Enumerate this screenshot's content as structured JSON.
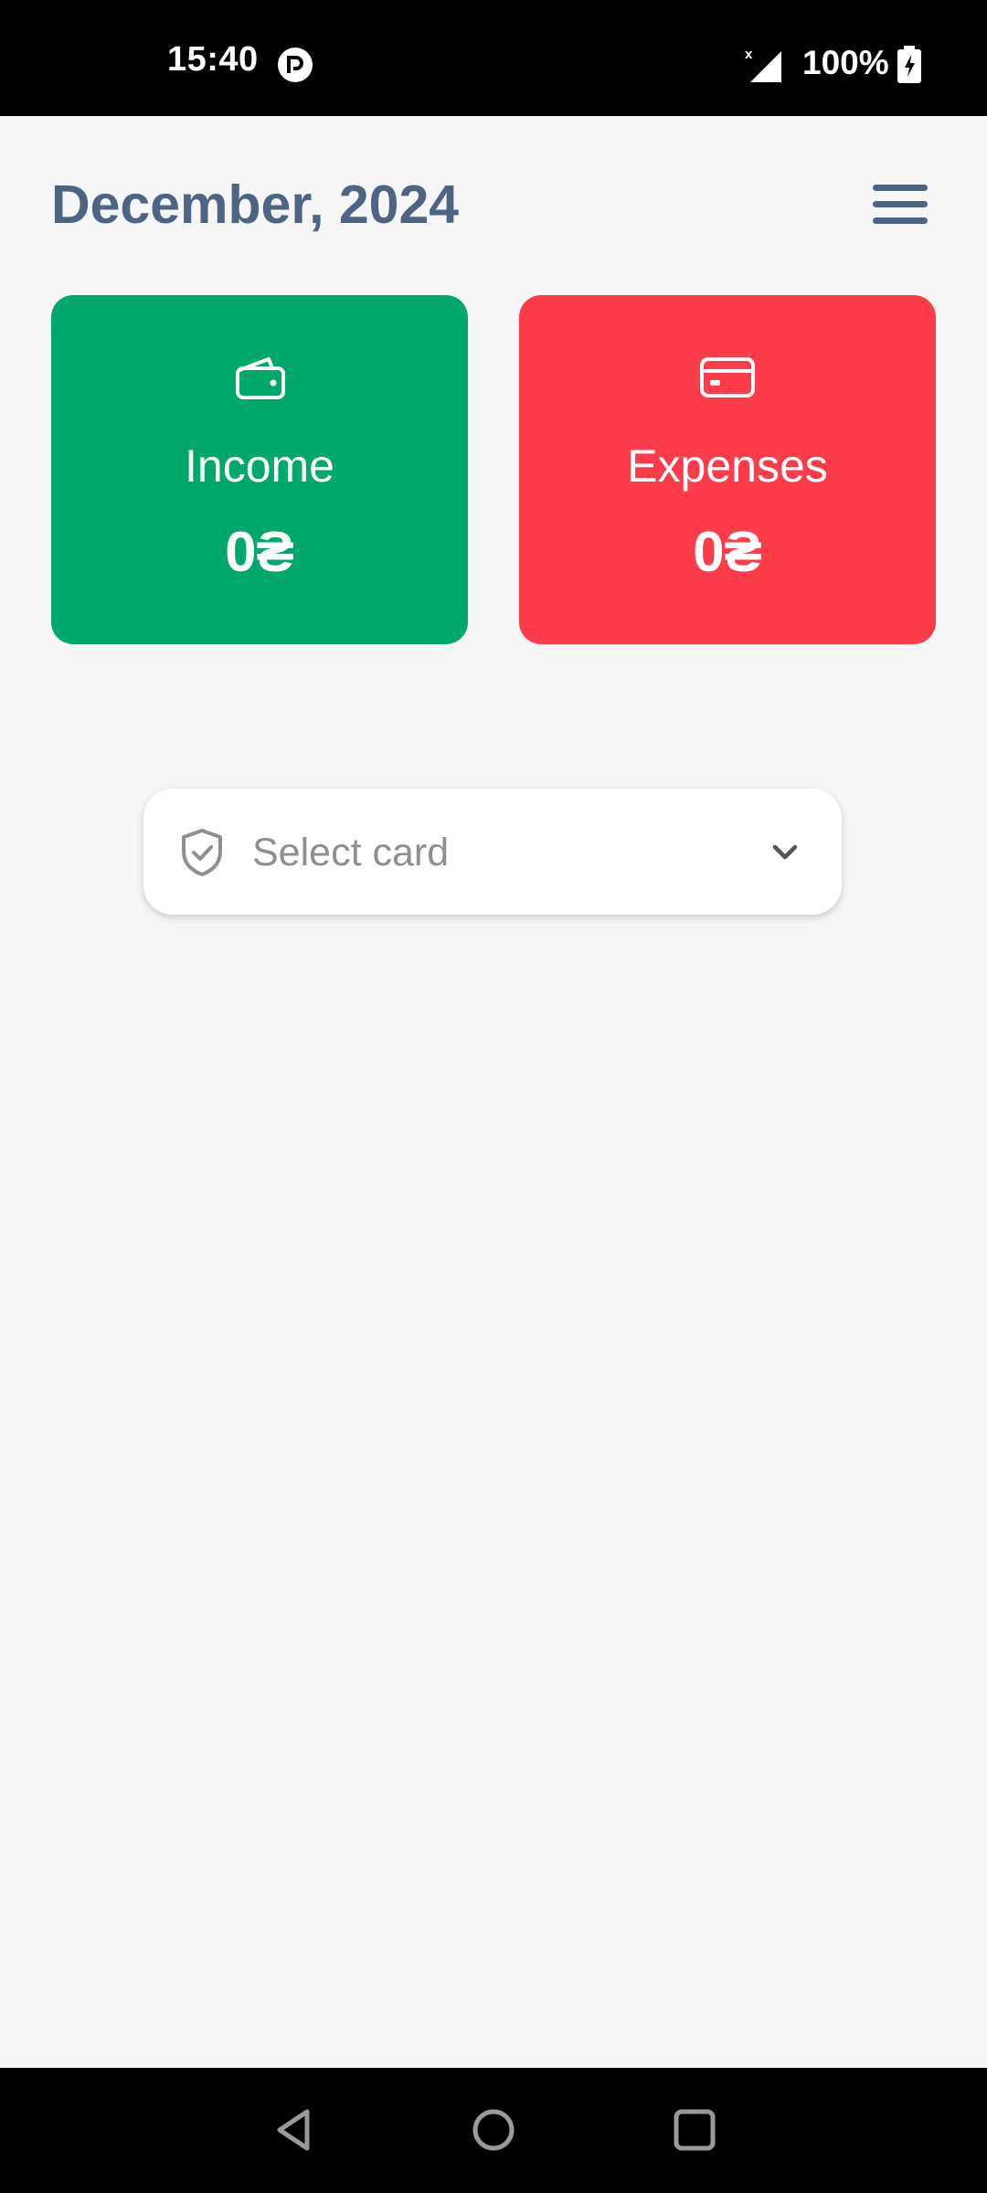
{
  "status_bar": {
    "time": "15:40",
    "battery": "100%",
    "icons": [
      "app-notification-icon",
      "signal-icon",
      "battery-charging-icon"
    ]
  },
  "header": {
    "title": "December, 2024",
    "menu_icon": "hamburger-menu-icon"
  },
  "summary": {
    "income": {
      "label": "Income",
      "amount": "0₴",
      "icon": "wallet-icon",
      "color": "#00a86b"
    },
    "expenses": {
      "label": "Expenses",
      "amount": "0₴",
      "icon": "credit-card-icon",
      "color": "#fd3c4a"
    }
  },
  "card_select": {
    "placeholder": "Select card",
    "icon": "shield-check-icon",
    "dropdown_icon": "chevron-down-icon"
  },
  "nav": {
    "icons": [
      "back-icon",
      "home-icon",
      "recent-apps-icon"
    ]
  },
  "colors": {
    "title": "#4e6483",
    "background": "#f6f6f7"
  }
}
